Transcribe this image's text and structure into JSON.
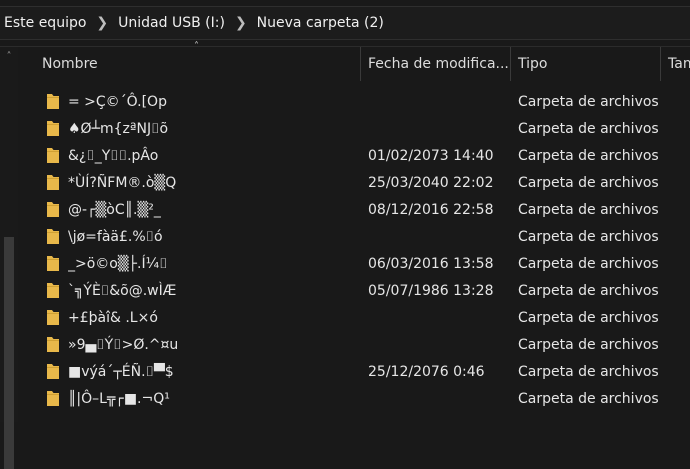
{
  "address": {
    "crumbs": [
      "Este equipo",
      "Unidad USB (I:)",
      "Nueva carpeta (2)"
    ]
  },
  "columns": {
    "name": "Nombre",
    "date": "Fecha de modifica...",
    "type": "Tipo",
    "size": "Tam"
  },
  "colors": {
    "background": "#191919",
    "folder": "#e8b84a",
    "text": "#e6e6e6"
  },
  "rows": [
    {
      "name": " = >Ç©´Ô.[Op",
      "date": "",
      "type": "Carpeta de archivos"
    },
    {
      "name": "♠Ø┴m{zªNJ⌷õ",
      "date": "",
      "type": "Carpeta de archivos"
    },
    {
      "name": "&¿⌷_Y⌷⌷.pÂo",
      "date": "01/02/2073 14:40",
      "type": "Carpeta de archivos"
    },
    {
      "name": "*ÙÍ?ÑFM®.ò▒Q",
      "date": "25/03/2040 22:02",
      "type": "Carpeta de archivos"
    },
    {
      "name": "@-┌▒òC║.▒²_",
      "date": "08/12/2016 22:58",
      "type": "Carpeta de archivos"
    },
    {
      "name": "\\jø=fàä£.%⌷ó",
      "date": "",
      "type": "Carpeta de archivos"
    },
    {
      "name": "_>ö©o▒├.Í¼⌷",
      "date": "06/03/2016 13:58",
      "type": "Carpeta de archivos"
    },
    {
      "name": "`╗ÝÈ⌷&õ@.wÌÆ",
      "date": "05/07/1986 13:28",
      "type": "Carpeta de archivos"
    },
    {
      "name": "+£þàî& .L×ó",
      "date": "",
      "type": "Carpeta de archivos"
    },
    {
      "name": "»9▄⌷Ý⌷>Ø.^¤u",
      "date": "",
      "type": "Carpeta de archivos"
    },
    {
      "name": "■výá´┬ÉÑ.⌷▀$",
      "date": "25/12/2076 0:46",
      "type": "Carpeta de archivos"
    },
    {
      "name": "║|Ô–L╦┌■.¬Q¹",
      "date": "",
      "type": "Carpeta de archivos"
    }
  ]
}
